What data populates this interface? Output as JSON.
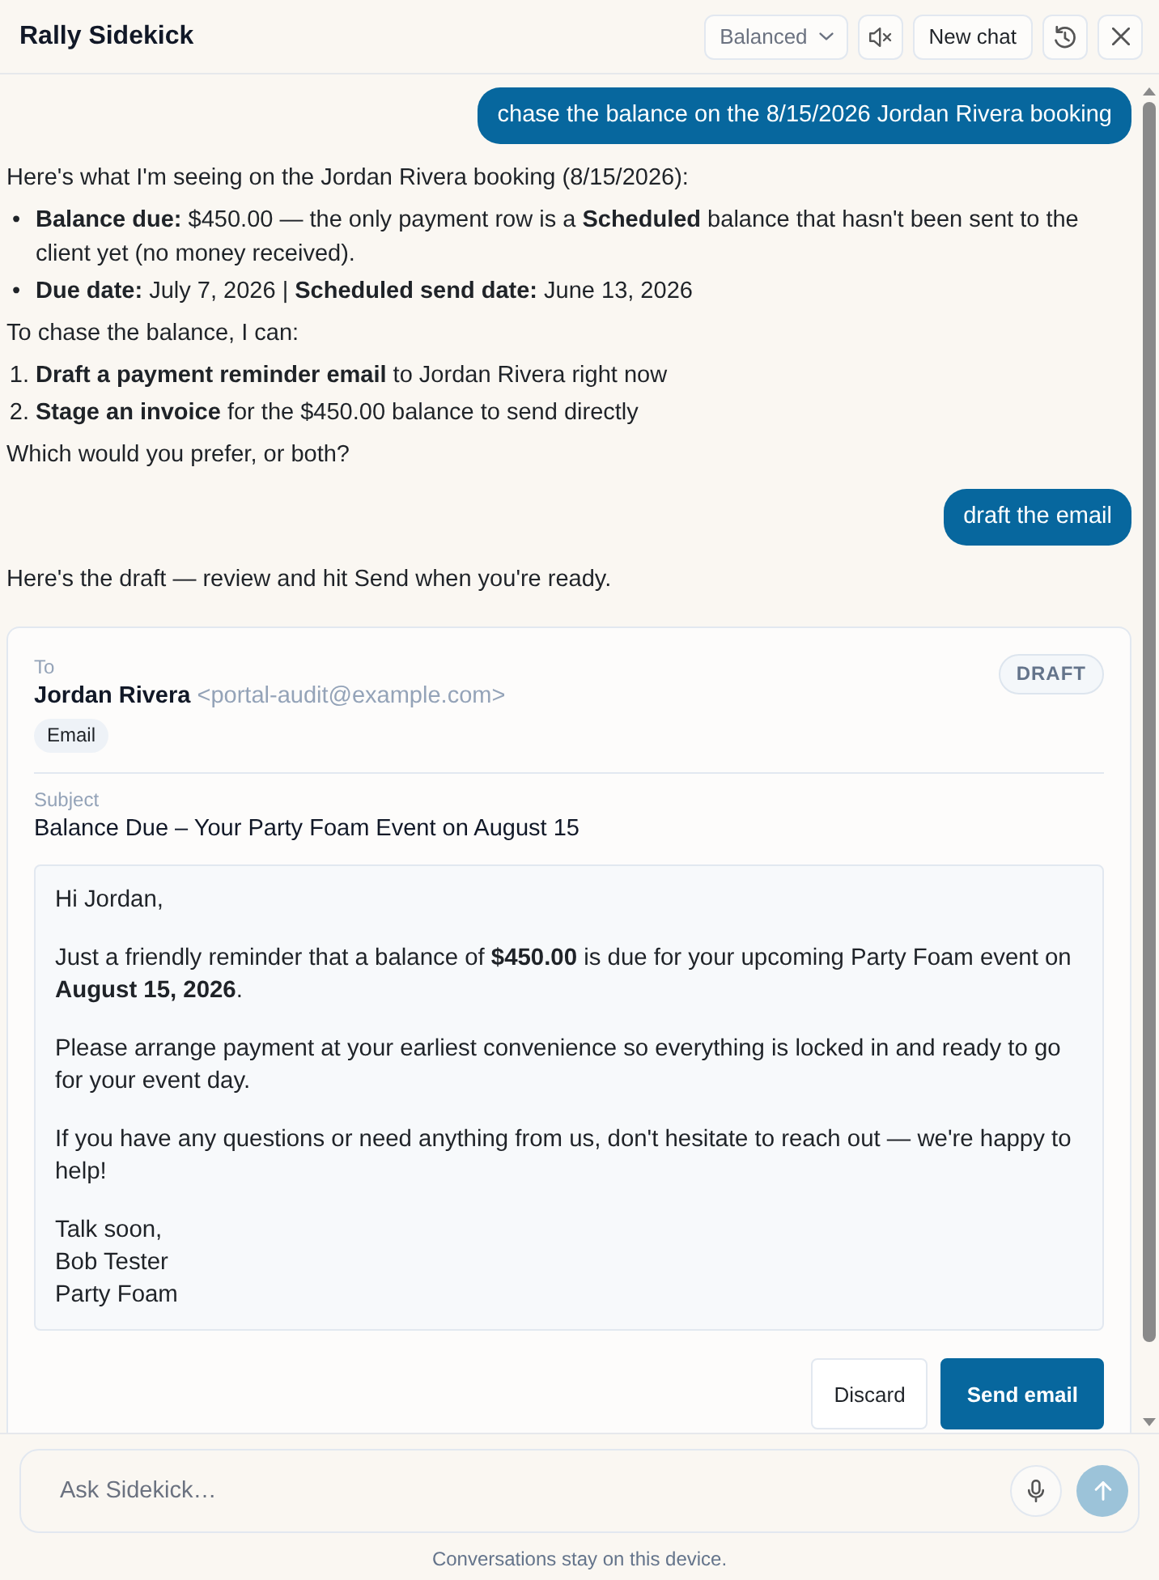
{
  "header": {
    "title": "Rally Sidekick",
    "mode": "Balanced",
    "sound_muted": true,
    "new_chat": "New chat"
  },
  "messages": [
    {
      "kind": "user",
      "text": "chase the balance on the 8/15/2026 Jordan Rivera booking"
    },
    {
      "kind": "assistant",
      "blocks": [
        {
          "kind": "p",
          "text": "Here's what I'm seeing on the Jordan Rivera booking (8/15/2026):"
        },
        {
          "kind": "ul",
          "items": [
            {
              "marker": "•",
              "text": "**Balance due:** $450.00 — the only payment row is a **Scheduled** balance that hasn't been sent to the client yet (no money received)."
            },
            {
              "marker": "•",
              "text": "**Due date:** July 7, 2026 | **Scheduled send date:** June 13, 2026"
            }
          ]
        },
        {
          "kind": "p",
          "text": "To chase the balance, I can:"
        },
        {
          "kind": "ol",
          "items": [
            {
              "marker": "1.",
              "text": "**Draft a payment reminder email** to Jordan Rivera right now"
            },
            {
              "marker": "2.",
              "text": "**Stage an invoice** for the $450.00 balance to send directly"
            }
          ]
        },
        {
          "kind": "p",
          "text": "Which would you prefer, or both?"
        }
      ]
    },
    {
      "kind": "user",
      "text": "draft the email"
    },
    {
      "kind": "assistant",
      "blocks": [
        {
          "kind": "p",
          "text": "Here's the draft — review and hit Send when you're ready."
        }
      ]
    },
    {
      "kind": "email_draft",
      "to_label": "To",
      "recipient_name": "Jordan Rivera",
      "recipient_email": "<portal-audit@example.com>",
      "channel": "Email",
      "status": "DRAFT",
      "subject_label": "Subject",
      "subject": "Balance Due – Your Party Foam Event on August 15",
      "paragraphs": [
        "Hi Jordan,",
        "Just a friendly reminder that a balance of **$450.00** is due for your upcoming Party Foam event on **August 15, 2026**.",
        "Please arrange payment at your earliest convenience so everything is locked in and ready to go for your event day.",
        "If you have any questions or need anything from us, don't hesitate to reach out — we're happy to help!"
      ],
      "signature": [
        "Talk soon,",
        "Bob Tester",
        "Party Foam"
      ],
      "buttons": [
        {
          "kind": "secondary",
          "label": "Discard"
        },
        {
          "kind": "primary",
          "label": "Send email"
        }
      ]
    }
  ],
  "composer": {
    "placeholder": "Ask Sidekick…",
    "send_disabled": true,
    "note": "Conversations stay on this device."
  }
}
